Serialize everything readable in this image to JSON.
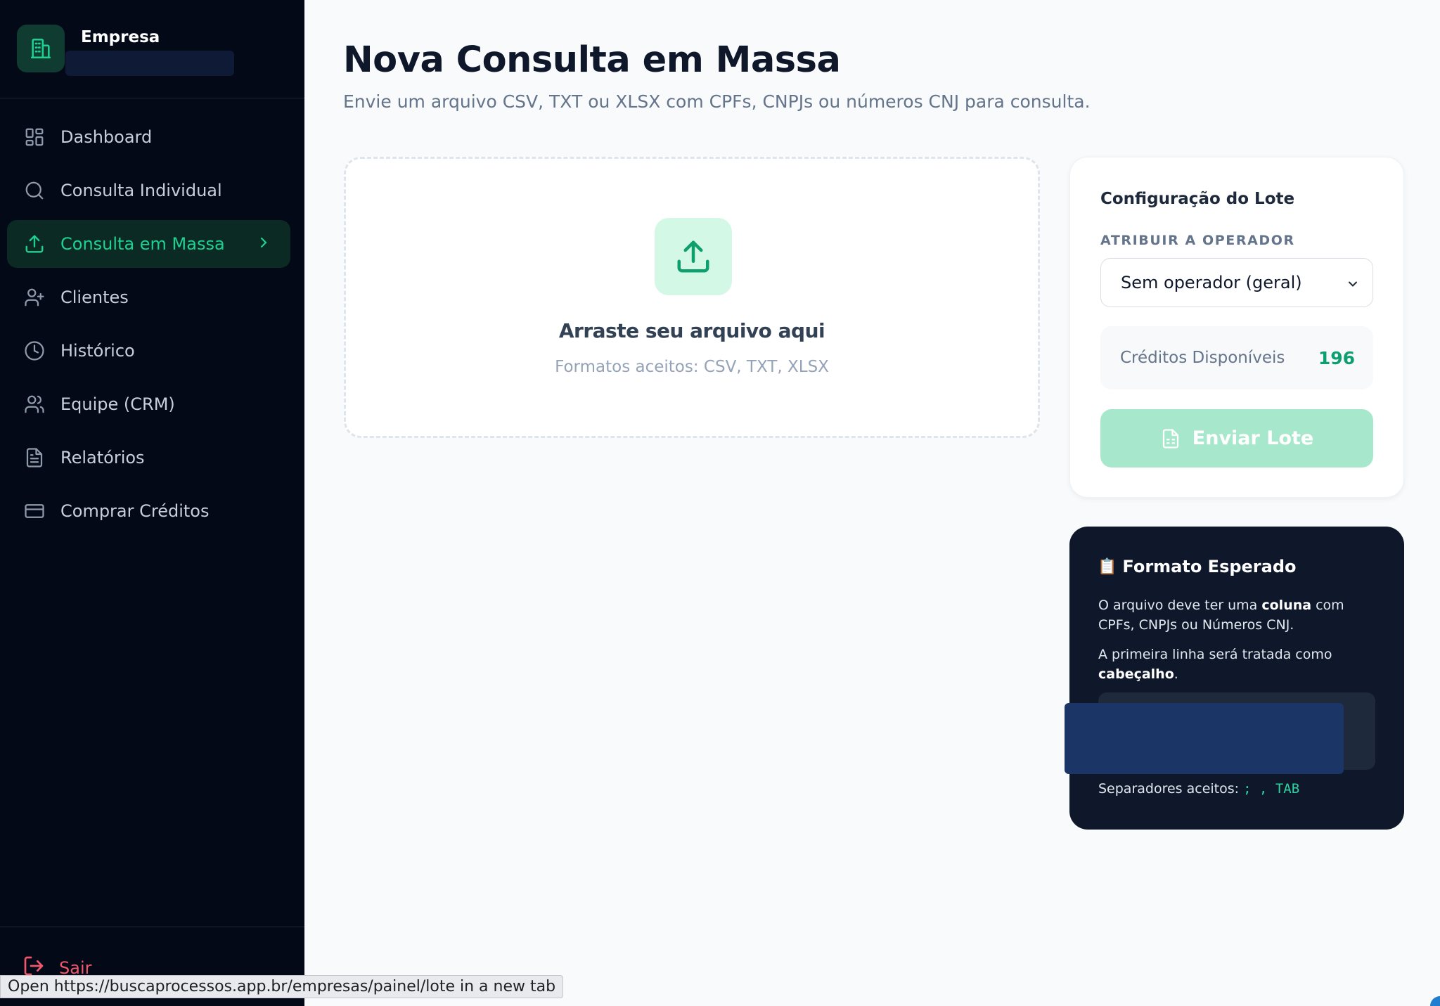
{
  "brand": {
    "name": "Empresa",
    "accent": "#1fd191"
  },
  "sidebar": {
    "items": [
      {
        "label": "Dashboard",
        "icon": "dashboard-grid-icon"
      },
      {
        "label": "Consulta Individual",
        "icon": "search-icon"
      },
      {
        "label": "Consulta em Massa",
        "icon": "upload-icon",
        "active": true
      },
      {
        "label": "Clientes",
        "icon": "user-plus-icon"
      },
      {
        "label": "Histórico",
        "icon": "clock-icon"
      },
      {
        "label": "Equipe (CRM)",
        "icon": "users-icon"
      },
      {
        "label": "Relatórios",
        "icon": "document-icon"
      },
      {
        "label": "Comprar Créditos",
        "icon": "credit-card-icon"
      }
    ],
    "logout_label": "Sair"
  },
  "main": {
    "title": "Nova Consulta em Massa",
    "subtitle": "Envie um arquivo CSV, TXT ou XLSX com CPFs, CNPJs ou números CNJ para consulta."
  },
  "dropzone": {
    "title": "Arraste seu arquivo aqui",
    "subtitle": "Formatos aceitos: CSV, TXT, XLSX"
  },
  "config": {
    "title": "Configuração do Lote",
    "operator_label": "ATRIBUIR A OPERADOR",
    "operator_selected": "Sem operador (geral)",
    "credits_label": "Créditos Disponíveis",
    "credits_value": "196",
    "send_label": "Enviar Lote"
  },
  "format": {
    "title": "Formato Esperado",
    "p1_a": "O arquivo deve ter uma ",
    "p1_b": "coluna",
    "p1_c": " com CPFs, CNPJs ou Números CNJ.",
    "p2_a": "A primeira linha será tratada como ",
    "p2_b": "cabeçalho",
    "p2_c": ".",
    "separators_label": "Separadores aceitos: ",
    "separators_value": "; , TAB"
  },
  "status_bar": {
    "prefix": "Open ",
    "url": "https://buscaprocessos.app.br/empresas/painel/lote",
    "suffix": " in a new tab"
  }
}
